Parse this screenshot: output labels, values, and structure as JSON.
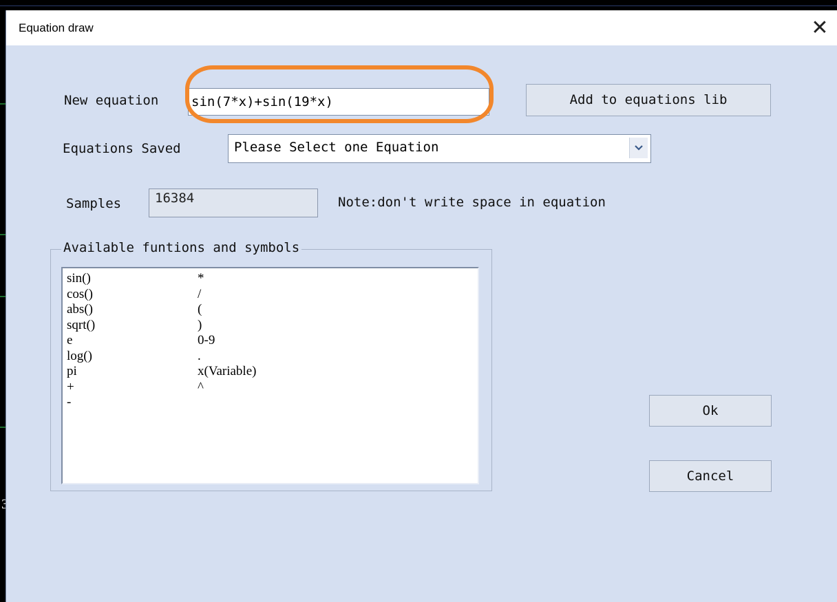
{
  "dialog": {
    "title": "Equation draw",
    "close_icon": "close-icon"
  },
  "new_equation": {
    "label": "New equation",
    "value": "sin(7*x)+sin(19*x)",
    "add_button": "Add to equations lib"
  },
  "saved": {
    "label": "Equations Saved",
    "selected": "Please Select one Equation"
  },
  "samples": {
    "label": "Samples",
    "value": "16384",
    "note": "Note:don't write space in equation"
  },
  "functions": {
    "title": "Available funtions and symbols",
    "rows": [
      {
        "fn": "sin()",
        "sym": "*"
      },
      {
        "fn": "cos()",
        "sym": "/"
      },
      {
        "fn": "abs()",
        "sym": "("
      },
      {
        "fn": "sqrt()",
        "sym": ")"
      },
      {
        "fn": "e",
        "sym": "0-9"
      },
      {
        "fn": "log()",
        "sym": "."
      },
      {
        "fn": "pi",
        "sym": "x(Variable)"
      },
      {
        "fn": "+",
        "sym": "^"
      },
      {
        "fn": "-",
        "sym": ""
      }
    ]
  },
  "buttons": {
    "ok": "Ok",
    "cancel": "Cancel"
  },
  "background": {
    "digit": "3"
  },
  "colors": {
    "dialog_bg": "#d5dff1",
    "highlight_ring": "#f2872c"
  }
}
